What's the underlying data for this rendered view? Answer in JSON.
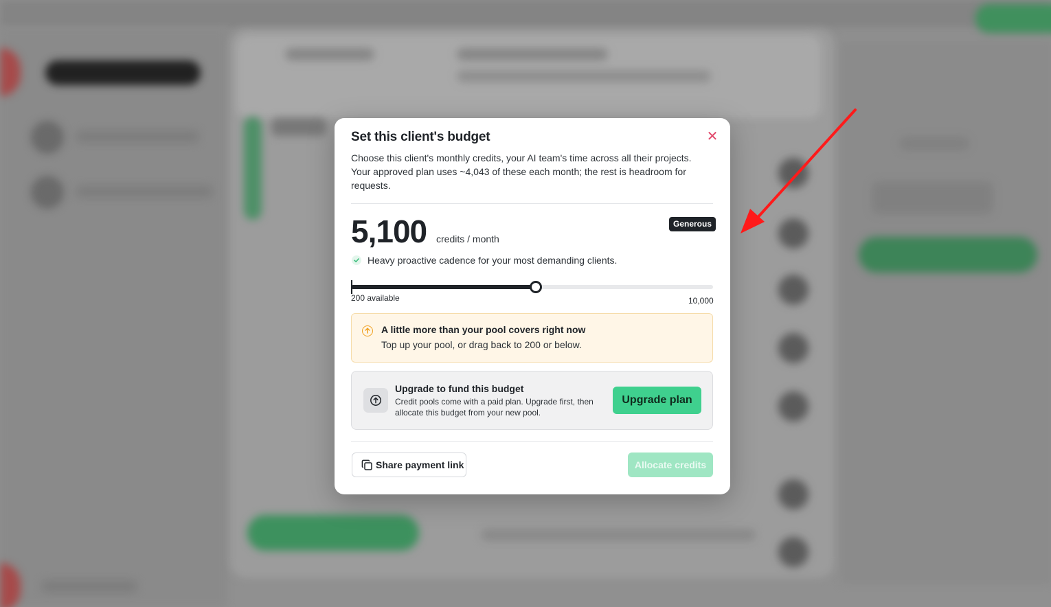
{
  "modal": {
    "title": "Set this client's budget",
    "description": "Choose this client's monthly credits, your AI team's time across all their projects. Your approved plan uses ~4,043 of these each month; the rest is headroom for requests.",
    "amount": "5,100",
    "amount_unit": "credits / month",
    "tier_badge": "Generous",
    "tier_description": "Heavy proactive cadence for your most demanding clients.",
    "slider": {
      "min_label": "200 available",
      "max_label": "10,000",
      "max_value": 10000,
      "value": 5100
    },
    "warning": {
      "title": "A little more than your pool covers right now",
      "text": "Top up your pool, or drag back to 200 or below."
    },
    "upgrade": {
      "title": "Upgrade to fund this budget",
      "text": "Credit pools come with a paid plan. Upgrade first, then allocate this budget from your new pool.",
      "button_label": "Upgrade plan"
    },
    "share_label": "Share payment link",
    "allocate_label": "Allocate credits"
  },
  "icons": {
    "close": "close-icon",
    "check": "check-icon",
    "warning": "arrow-up-circle-icon",
    "upgrade": "arrow-up-circle-icon",
    "share": "copy-icon"
  },
  "colors": {
    "accent_green": "#3fd08e",
    "close_red": "#e2496b",
    "warning_bg": "#fff6e7",
    "warning_icon": "#f0a020",
    "annotation_arrow": "#ff1a1a"
  }
}
